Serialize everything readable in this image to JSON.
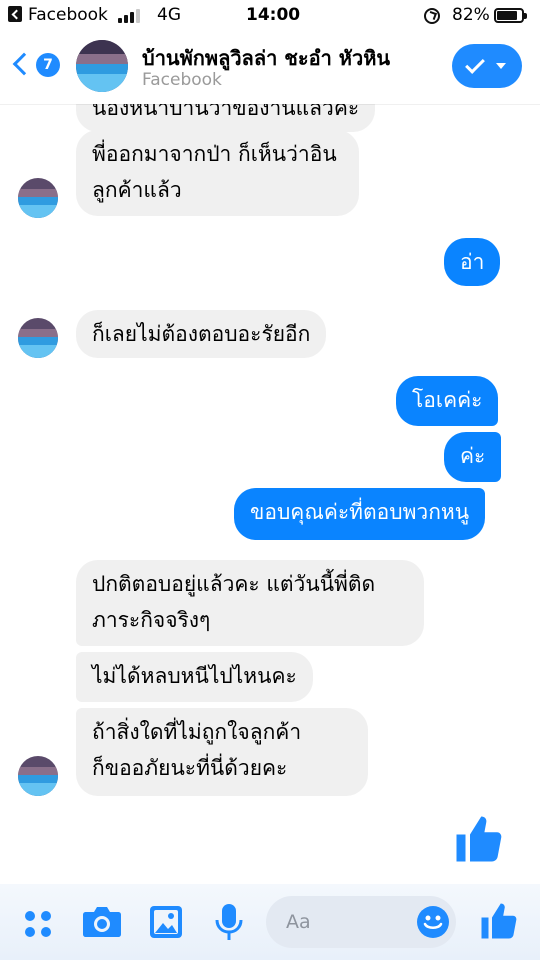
{
  "status_bar": {
    "app_name": "Facebook",
    "network": "4G",
    "time": "14:00",
    "battery_percent": "82%",
    "battery_level": 0.82
  },
  "header": {
    "badge_count": "7",
    "title": "บ้านพักพลูวิลล่า ชะอำ หัวหิน",
    "subtitle": "Facebook"
  },
  "messages": [
    {
      "from": "page",
      "text": "น้องหน้าบ้านว่าของานแล้วค่ะ"
    },
    {
      "from": "page",
      "lines": [
        "พี่ออกมาจากป่า ก็เห็นว่าอิน",
        "ลูกค้าแล้ว"
      ]
    },
    {
      "from": "me",
      "text": "อ่า"
    },
    {
      "from": "page",
      "text": "ก็เลยไม่ต้องตอบอะรัยอีก"
    },
    {
      "from": "me",
      "text": "โอเคค่ะ"
    },
    {
      "from": "me",
      "text": "ค่ะ"
    },
    {
      "from": "me",
      "text": "ขอบคุณค่ะที่ตอบพวกหนู"
    },
    {
      "from": "page",
      "lines": [
        "ปกติตอบอยู่แล้วคะ แต่วันนี้พี่ติด",
        "ภาระกิจจริงๆ"
      ]
    },
    {
      "from": "page",
      "text": "ไม่ได้หลบหนีไปไหนคะ"
    },
    {
      "from": "page",
      "lines": [
        "ถ้าสิ่งใดที่ไม่ถูกใจลูกค้า",
        "ก็ขออภัยนะที่นี่ด้วยคะ"
      ]
    }
  ],
  "composer": {
    "placeholder": "Aa"
  },
  "icons": {
    "menu": "grid-dots-icon",
    "camera": "camera-icon",
    "gallery": "image-icon",
    "voice": "microphone-icon",
    "emoji": "smiley-icon",
    "like": "thumbs-up-icon"
  },
  "colors": {
    "accent": "#1f8bff",
    "outgoing_bubble": "#0a84ff",
    "incoming_bubble": "#f0f0f0"
  }
}
